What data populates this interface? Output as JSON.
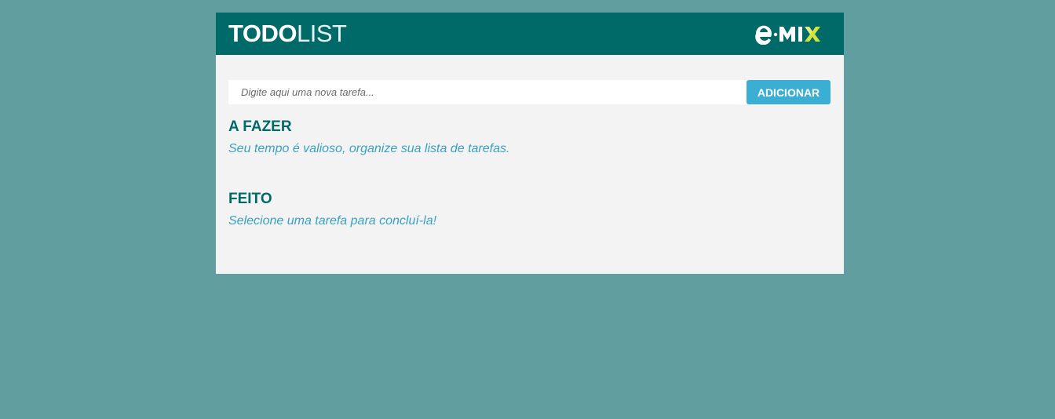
{
  "header": {
    "title_bold": "TODO",
    "title_light": "LIST",
    "logo_text": "e·MIX",
    "logo_icon": "emix-logo"
  },
  "form": {
    "placeholder": "Digite aqui uma nova tarefa...",
    "value": "",
    "add_label": "ADICIONAR"
  },
  "sections": {
    "todo": {
      "title": "A FAZER",
      "empty_message": "Seu tempo é valioso, organize sua lista de tarefas."
    },
    "done": {
      "title": "FEITO",
      "empty_message": "Selecione uma tarefa para concluí-la!"
    }
  },
  "colors": {
    "page_background": "#609ea0",
    "header": "#006a68",
    "panel": "#f3f3f3",
    "button": "#3aafd3",
    "section_title": "#006a68",
    "message": "#3aa0c3",
    "logo_accent": "#d4e23a"
  }
}
